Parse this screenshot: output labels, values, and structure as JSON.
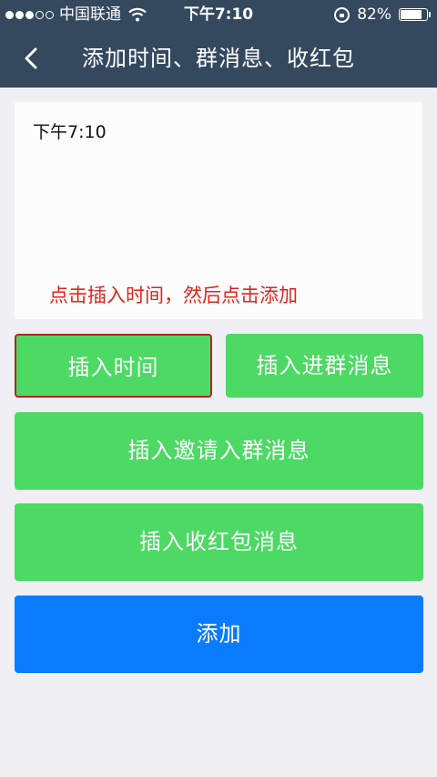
{
  "status_bar": {
    "carrier": "中国联通",
    "time": "下午7:10",
    "battery_percent": "82%",
    "battery_level": 0.82
  },
  "nav": {
    "title": "添加时间、群消息、收红包"
  },
  "preview": {
    "text": "下午7:10",
    "hint": "点击插入时间，然后点击添加"
  },
  "buttons": {
    "insert_time": "插入时间",
    "insert_join": "插入进群消息",
    "insert_invite": "插入邀请入群消息",
    "insert_redpacket": "插入收红包消息",
    "add": "添加"
  },
  "colors": {
    "nav_bg": "#34495e",
    "green": "#4cd964",
    "blue": "#0a7bfd",
    "hint_red": "#e0241b"
  }
}
